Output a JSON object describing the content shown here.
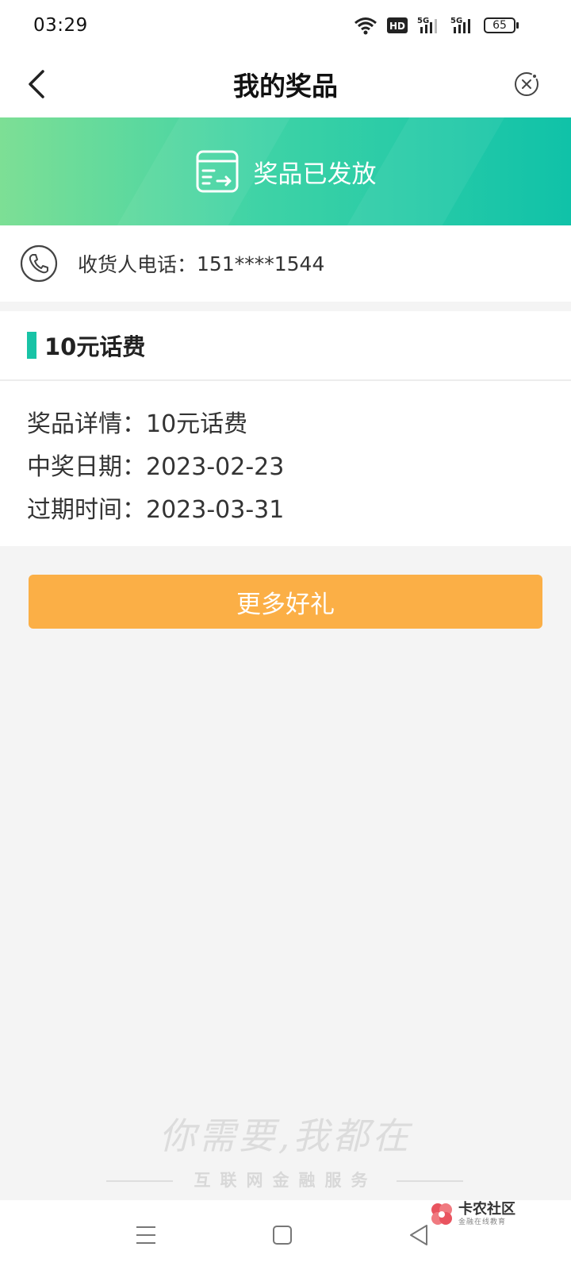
{
  "status_bar": {
    "time": "03:29",
    "hd_label": "HD",
    "signal1_label": "5G",
    "signal2_label": "5G",
    "battery": "65"
  },
  "nav": {
    "title": "我的奖品"
  },
  "banner": {
    "text": "奖品已发放",
    "icon": "delivery-card-icon"
  },
  "contact": {
    "label": "收货人电话：",
    "value": "151****1544",
    "icon": "phone-icon"
  },
  "prize": {
    "title": "10元话费",
    "accent_color": "#18c3a6",
    "details": [
      {
        "label": "奖品详情：",
        "value": "10元话费"
      },
      {
        "label": "中奖日期：",
        "value": "2023-02-23"
      },
      {
        "label": "过期时间：",
        "value": "2023-03-31"
      }
    ]
  },
  "actions": {
    "more_label": "更多好礼",
    "more_color": "#fbaf46"
  },
  "watermark": {
    "script_text": "你需要,我都在",
    "subtitle": "互联网金融服务"
  },
  "brand_badge": {
    "name": "卡农社区",
    "tagline": "金融在线教育"
  }
}
